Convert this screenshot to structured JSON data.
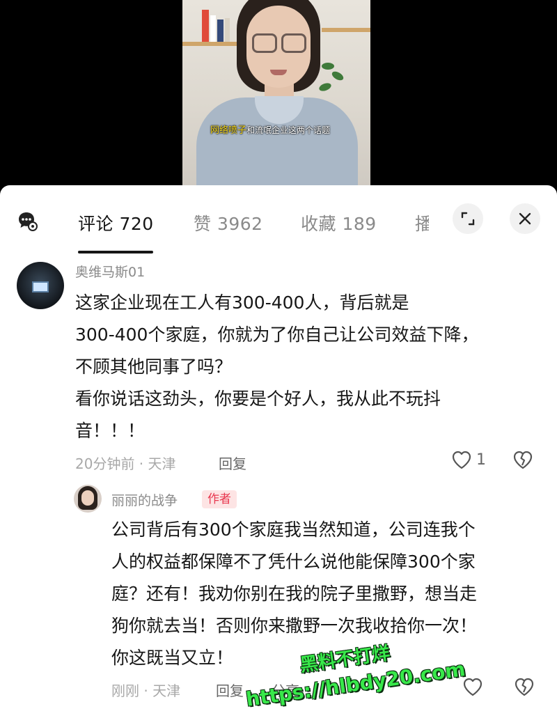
{
  "video": {
    "caption_highlight": "网络喷子",
    "caption_rest": "和流氓企业这两个话题"
  },
  "tabs": {
    "comments": "评论 720",
    "likes": "赞 3962",
    "favorites": "收藏 189",
    "more": "播"
  },
  "comments": [
    {
      "username": "奥维马斯01",
      "lines": [
        "这家企业现在工人有300-400人，背后就是",
        "300-400个家庭，你就为了你自己让公司效益下降，",
        "不顾其他同事了吗？",
        "看你说话这劲头，你要是个好人，我从此不玩抖",
        "音！！！"
      ],
      "meta": "20分钟前 · 天津",
      "reply_label": "回复",
      "like_count": "1"
    }
  ],
  "reply": {
    "username": "丽丽的战争",
    "badge": "作者",
    "lines": [
      "公司背后有300个家庭我当然知道，公司连我个",
      "人的权益都保障不了凭什么说他能保障300个家",
      "庭？还有！我劝你别在我的院子里撒野，想当走",
      "狗你就去当！否则你来撒野一次我收拾你一次！",
      "你这既当又立！"
    ],
    "meta": "刚刚 · 天津",
    "reply_label": "回复",
    "share_label": "分享"
  },
  "watermark": {
    "line1": "黑料不打烊",
    "line2": "https://hlbdy20.com"
  },
  "colors": {
    "accent_red": "#e8384f",
    "watermark_green": "#38e84a",
    "caption_yellow": "#f2d41a"
  }
}
